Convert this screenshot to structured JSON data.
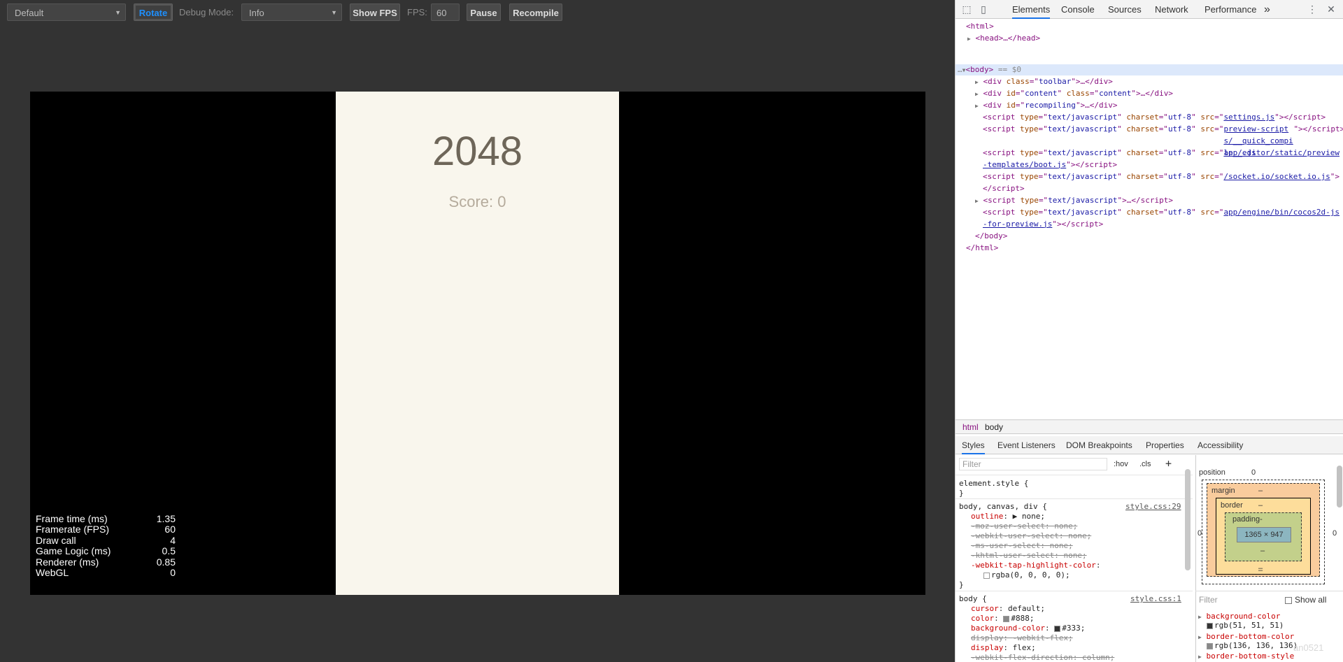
{
  "toolbar": {
    "device_select": "Default",
    "rotate_label": "Rotate",
    "debug_mode_label": "Debug Mode:",
    "debug_mode_value": "Info",
    "show_fps_label": "Show FPS",
    "fps_label": "FPS:",
    "fps_value": "60",
    "pause_label": "Pause",
    "recompile_label": "Recompile"
  },
  "game": {
    "title": "2048",
    "score": "Score: 0"
  },
  "stats": [
    {
      "label": "Frame time (ms)",
      "value": "1.35"
    },
    {
      "label": "Framerate (FPS)",
      "value": "60"
    },
    {
      "label": "Draw call",
      "value": "4"
    },
    {
      "label": "Game Logic (ms)",
      "value": "0.5"
    },
    {
      "label": "Renderer (ms)",
      "value": "0.85"
    },
    {
      "label": "WebGL",
      "value": "0"
    }
  ],
  "devtools": {
    "tabs": [
      "Elements",
      "Console",
      "Sources",
      "Network",
      "Performance"
    ],
    "more_tabs": "»",
    "close": "✕",
    "dom": {
      "html_open": "<html>",
      "head": "<head>…</head>",
      "body_open": "<body>",
      "body_marker": "== $0",
      "div_toolbar": {
        "class": "toolbar"
      },
      "div_content": {
        "id": "content",
        "class": "content"
      },
      "div_recompiling": {
        "id": "recompiling"
      },
      "scripts": [
        {
          "src": "settings.js"
        },
        {
          "src": "preview-scripts/__quick_compile__.js"
        },
        {
          "src": "app/editor/static/preview-templates/boot.js"
        },
        {
          "src": "/socket.io/socket.io.js"
        },
        {
          "src": "app/engine/bin/cocos2d-js-for-preview.js"
        }
      ],
      "script_type": "text/javascript",
      "script_charset": "utf-8",
      "body_close": "</body>",
      "html_close": "</html>"
    },
    "breadcrumbs": [
      "html",
      "body"
    ],
    "sub_tabs": [
      "Styles",
      "Event Listeners",
      "DOM Breakpoints",
      "Properties",
      "Accessibility"
    ],
    "styles": {
      "filter_placeholder": "Filter",
      "hov": ":hov",
      "cls": ".cls",
      "plus": "+",
      "element_style": "element.style {",
      "rule1_selector": "body, canvas, div {",
      "rule1_source": "style.css:29",
      "rule1_props": [
        {
          "name": "outline",
          "value": "▶ none;",
          "struck": false
        },
        {
          "name": "-moz-user-select",
          "value": "none;",
          "struck": true
        },
        {
          "name": "-webkit-user-select",
          "value": "none;",
          "struck": true
        },
        {
          "name": "-ms-user-select",
          "value": "none;",
          "struck": true
        },
        {
          "name": "-khtml-user-select",
          "value": "none;",
          "struck": true
        },
        {
          "name": "-webkit-tap-highlight-color",
          "value": "",
          "struck": false
        }
      ],
      "tap_color": "rgba(0, 0, 0, 0);",
      "rule2_selector": "body {",
      "rule2_source": "style.css:1",
      "rule2_props": [
        {
          "name": "cursor",
          "value": "default;",
          "struck": false
        },
        {
          "name": "color",
          "value": "#888;",
          "struck": false,
          "swatch": "#888888"
        },
        {
          "name": "background-color",
          "value": "#333;",
          "struck": false,
          "swatch": "#333333"
        },
        {
          "name": "display",
          "value": "-webkit-flex;",
          "struck": true
        },
        {
          "name": "display",
          "value": "flex;",
          "struck": false
        },
        {
          "name": "-webkit-flex-direction",
          "value": "column;",
          "struck": true
        }
      ],
      "close_brace": "}"
    },
    "box_model": {
      "position_label": "position",
      "position_value": "0",
      "margin_label": "margin",
      "border_label": "border",
      "padding_label": "padding-",
      "content_size": "1365 × 947",
      "dash": "–",
      "zero": "0"
    },
    "computed": {
      "filter_placeholder": "Filter",
      "show_all": "Show all",
      "props": [
        {
          "name": "background-color",
          "value": "rgb(51, 51, 51)",
          "swatch": "#333333"
        },
        {
          "name": "border-bottom-color",
          "value": "rgb(136, 136, 136)",
          "swatch": "#888888"
        },
        {
          "name": "border-bottom-style",
          "value": ""
        }
      ],
      "watermark": "an0521"
    }
  }
}
